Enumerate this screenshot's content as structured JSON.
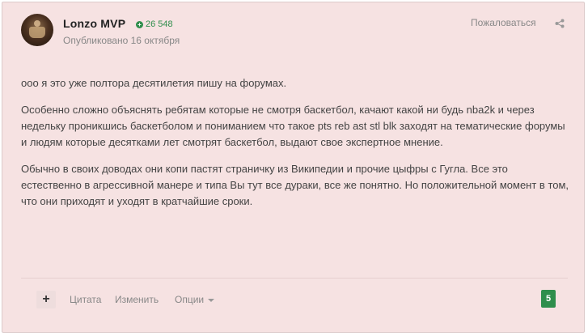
{
  "post": {
    "author": "Lonzo MVP",
    "reputation": "26 548",
    "published": "Опубликовано 16 октября",
    "report_label": "Пожаловаться",
    "share_icon": "share-icon",
    "paragraphs": [
      "ооо я это уже полтора десятилетия пишу на форумах.",
      "Особенно сложно объяснять ребятам которые не смотря баскетбол, качают какой ни будь nba2k и через недельку проникшись баскетболом и пониманием что такое pts reb ast stl blk заходят на тематические форумы и людям которые десятками лет смотрят баскетбол, выдают свое экспертное мнение.",
      "Обычно в своих доводах они копи пастят страничку из Википедии и прочие цыфры с Гугла. Все это естественно в агрессивной манере и типа Вы тут все дураки, все же понятно. Но положительной момент в том, что они приходят и уходят в кратчайшие сроки."
    ],
    "footer": {
      "plus_label": "+",
      "quote_label": "Цитата",
      "edit_label": "Изменить",
      "options_label": "Опции",
      "reputation_count": "5"
    }
  },
  "colors": {
    "post_background": "#f6e2e2",
    "accent_green": "#2f8e4c"
  }
}
